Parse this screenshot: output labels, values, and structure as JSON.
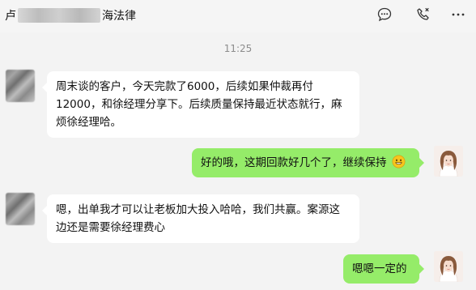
{
  "header": {
    "name_prefix": "卢",
    "name_suffix": "海法律",
    "icons": [
      "chat-more-icon",
      "phone-icon",
      "more-icon"
    ]
  },
  "timestamp": "11:25",
  "messages": [
    {
      "side": "left",
      "text": "周末谈的客户，今天完款了6000，后续如果仲裁再付12000，和徐经理分享下。后续质量保持最近状态就行，麻烦徐经理哈。"
    },
    {
      "side": "right",
      "text": "好的哦，这期回款好几个了，继续保持",
      "emoji": "smile-emoji"
    },
    {
      "side": "left",
      "text": "嗯，出单我才可以让老板加大投入哈哈，我们共赢。案源这边还是需要徐经理费心"
    },
    {
      "side": "right",
      "text": "嗯嗯一定的"
    }
  ],
  "colors": {
    "bg": "#f3f3f3",
    "bubble_in": "#ffffff",
    "bubble_out": "#95ec69"
  }
}
